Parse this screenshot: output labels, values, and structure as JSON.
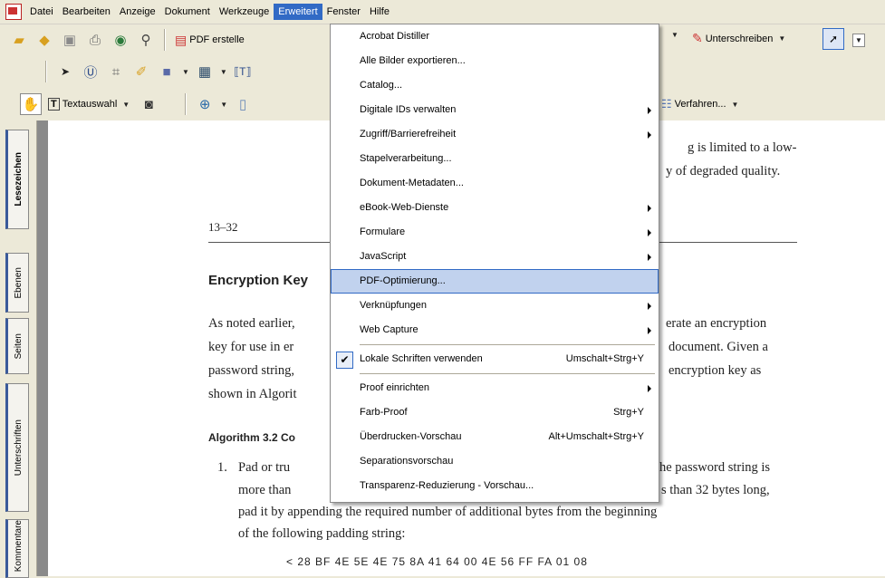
{
  "menubar": {
    "items": [
      "Datei",
      "Bearbeiten",
      "Anzeige",
      "Dokument",
      "Werkzeuge",
      "Erweitert",
      "Fenster",
      "Hilfe"
    ],
    "active_index": 5
  },
  "toolbar": {
    "pdf_create_label": "PDF erstelle",
    "sign_label": "Unterschreiben",
    "text_select_label": "Textauswahl",
    "procedure_label": "Verfahren..."
  },
  "sidebar": {
    "tabs": [
      "Lesezeichen",
      "Ebenen",
      "Seiten",
      "Unterschriften",
      "Kommentare"
    ]
  },
  "document": {
    "top_right_1": "g is limited to a low-",
    "top_right_2": "y of degraded quality.",
    "page_number": "13–32",
    "heading": "Encryption Key",
    "para_left_1": "As noted earlier,",
    "para_left_2": "key for use in er",
    "para_left_3": "password string,",
    "para_left_4": "shown in Algorit",
    "para_right_1": "erate an encryption",
    "para_right_2": "document. Given a",
    "para_right_3": "encryption key as",
    "algorithm_label": "Algorithm 3.2  Co",
    "step1_num": "1.",
    "step1_left_1": "Pad or tru",
    "step1_left_2": "more than",
    "step1_right_1": "he password string is",
    "step1_right_2": "s than 32 bytes long,",
    "step1_line3": "pad it by appending the required number of additional bytes from the beginning",
    "step1_line4": "of the following padding string:",
    "padding_string": "< 28 BF 4E 5E 4E 75 8A 41 64 00 4E 56 FF FA 01 08"
  },
  "dropdown": {
    "items": [
      {
        "label": "Acrobat Distiller",
        "shortcut": "",
        "submenu": false,
        "checked": false
      },
      {
        "label": "Alle Bilder exportieren...",
        "shortcut": "",
        "submenu": false,
        "checked": false
      },
      {
        "label": "Catalog...",
        "shortcut": "",
        "submenu": false,
        "checked": false
      },
      {
        "label": "Digitale IDs verwalten",
        "shortcut": "",
        "submenu": true,
        "checked": false
      },
      {
        "label": "Zugriff/Barrierefreiheit",
        "shortcut": "",
        "submenu": true,
        "checked": false
      },
      {
        "label": "Stapelverarbeitung...",
        "shortcut": "",
        "submenu": false,
        "checked": false
      },
      {
        "label": "Dokument-Metadaten...",
        "shortcut": "",
        "submenu": false,
        "checked": false
      },
      {
        "label": "eBook-Web-Dienste",
        "shortcut": "",
        "submenu": true,
        "checked": false
      },
      {
        "label": "Formulare",
        "shortcut": "",
        "submenu": true,
        "checked": false
      },
      {
        "label": "JavaScript",
        "shortcut": "",
        "submenu": true,
        "checked": false
      },
      {
        "label": "PDF-Optimierung...",
        "shortcut": "",
        "submenu": false,
        "checked": false,
        "highlighted": true
      },
      {
        "label": "Verknüpfungen",
        "shortcut": "",
        "submenu": true,
        "checked": false
      },
      {
        "label": "Web Capture",
        "shortcut": "",
        "submenu": true,
        "checked": false,
        "separator_after": true
      },
      {
        "label": "Lokale Schriften verwenden",
        "shortcut": "Umschalt+Strg+Y",
        "submenu": false,
        "checked": true,
        "separator_after": true
      },
      {
        "label": "Proof einrichten",
        "shortcut": "",
        "submenu": true,
        "checked": false
      },
      {
        "label": "Farb-Proof",
        "shortcut": "Strg+Y",
        "submenu": false,
        "checked": false
      },
      {
        "label": "Überdrucken-Vorschau",
        "shortcut": "Alt+Umschalt+Strg+Y",
        "submenu": false,
        "checked": false
      },
      {
        "label": "Separationsvorschau",
        "shortcut": "",
        "submenu": false,
        "checked": false
      },
      {
        "label": "Transparenz-Reduzierung - Vorschau...",
        "shortcut": "",
        "submenu": false,
        "checked": false
      }
    ]
  },
  "colors": {
    "menu_highlight": "#316ac5",
    "item_highlight": "#c1d2ee",
    "chrome": "#ece9d8"
  }
}
